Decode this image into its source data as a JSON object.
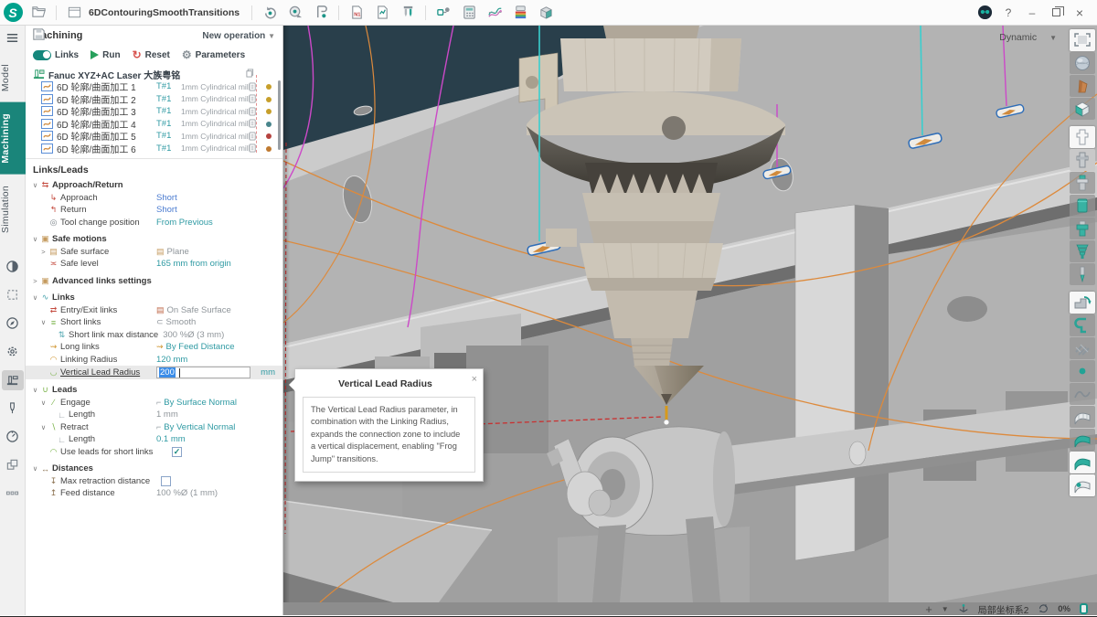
{
  "topbar": {
    "title": "6DContouringSmoothTransitions",
    "window_controls": {
      "help": "?",
      "minimize": "–",
      "close": "×"
    }
  },
  "sidebar": {
    "tabs": [
      {
        "label": "Model"
      },
      {
        "label": "Machining"
      },
      {
        "label": "Simulation"
      }
    ]
  },
  "panel": {
    "title": "Machining",
    "new_operation": "New operation",
    "controls": {
      "links": "Links",
      "run": "Run",
      "reset": "Reset",
      "parameters": "Parameters"
    },
    "machine_row": {
      "label": "Fanuc XYZ+AC Laser 大族粤铭"
    },
    "operations": [
      {
        "label": "6D 轮廓/曲面加工 1",
        "tool_no": "T#1",
        "tool": "1mm Cylindrical mill",
        "dot_color": "#c79f2b"
      },
      {
        "label": "6D 轮廓/曲面加工 2",
        "tool_no": "T#1",
        "tool": "1mm Cylindrical mill",
        "dot_color": "#c79f2b"
      },
      {
        "label": "6D 轮廓/曲面加工 3",
        "tool_no": "T#1",
        "tool": "1mm Cylindrical mill",
        "dot_color": "#c79f2b"
      },
      {
        "label": "6D 轮廓/曲面加工 4",
        "tool_no": "T#1",
        "tool": "1mm Cylindrical mill",
        "dot_color": "#49858c"
      },
      {
        "label": "6D 轮廓/曲面加工 5",
        "tool_no": "T#1",
        "tool": "1mm Cylindrical mill",
        "dot_color": "#b5433f"
      },
      {
        "label": "6D 轮廓/曲面加工 6",
        "tool_no": "T#1",
        "tool": "1mm Cylindrical mill",
        "dot_color": "#bf7a30"
      }
    ],
    "links_leads_title": "Links/Leads",
    "glyphs": {
      "approach-return": "⇆",
      "approach": "↳",
      "return": "↰",
      "tool-change": "◎",
      "safe-motions": "▣",
      "surface": "▤",
      "safe-level": "≍",
      "advanced": "▣",
      "links": "∿",
      "entry-exit": "⇄",
      "short-links": "≡",
      "max-distance": "⇅",
      "long-links": "⇝",
      "linking-radius": "◠",
      "vertical-lead-radius": "◡",
      "leads": "∪",
      "engage": "∕",
      "length": "∟",
      "retract": "∖",
      "use-leads": "◠",
      "distances": "↔",
      "max-retraction": "↧",
      "feed-distance": "↥",
      "plane": "▤",
      "safe-surface": "▤",
      "smooth": "⊂",
      "feed": "⇝",
      "corner": "⌐"
    },
    "tree": [
      {
        "sec": true,
        "chev": "v",
        "icon": "approach-return",
        "ic": "#c44a3e",
        "label": "Approach/Return"
      },
      {
        "ind": 1,
        "icon": "approach",
        "ic": "#c44a3e",
        "label": "Approach",
        "value": "Short",
        "vc": "blue"
      },
      {
        "ind": 1,
        "icon": "return",
        "ic": "#c44a3e",
        "label": "Return",
        "value": "Short",
        "vc": "blue"
      },
      {
        "ind": 1,
        "icon": "tool-change",
        "ic": "#7a8288",
        "label": "Tool change position",
        "value": "From Previous",
        "vc": "teal"
      },
      {
        "sec": true,
        "chev": "v",
        "icon": "safe-motions",
        "ic": "#c49a5e",
        "label": "Safe motions",
        "gap": true
      },
      {
        "ind": 1,
        "chev": ">",
        "icon": "surface",
        "ic": "#c49a5e",
        "label": "Safe surface",
        "value": "Plane",
        "vc": "gray",
        "vicon": "plane",
        "vicolor": "#c49a5e"
      },
      {
        "ind": 1,
        "icon": "safe-level",
        "ic": "#c44a3e",
        "label": "Safe level",
        "value": "165 mm from origin",
        "vc": "teal"
      },
      {
        "sec": true,
        "chev": ">",
        "icon": "advanced",
        "ic": "#c49a5e",
        "label": "Advanced links settings",
        "gap": true
      },
      {
        "sec": true,
        "chev": "v",
        "icon": "links",
        "ic": "#4aa3ad",
        "label": "Links",
        "gap": true
      },
      {
        "ind": 1,
        "icon": "entry-exit",
        "ic": "#c44a3e",
        "label": "Entry/Exit links",
        "value": "On Safe Surface",
        "vc": "gray",
        "vicon": "safe-surface",
        "vicolor": "#c06a4a"
      },
      {
        "ind": 1,
        "chev": "v",
        "icon": "short-links",
        "ic": "#76b043",
        "label": "Short links",
        "value": "Smooth",
        "vc": "gray",
        "vicon": "smooth",
        "vicolor": "#8a9096"
      },
      {
        "ind": 2,
        "icon": "max-distance",
        "ic": "#4aa3ad",
        "label": "Short link max distance",
        "value": "300 %Ø (3 mm)",
        "vc": "gray",
        "inline": true
      },
      {
        "ind": 1,
        "icon": "long-links",
        "ic": "#d0952f",
        "label": "Long links",
        "value": "By Feed Distance",
        "vc": "teal",
        "vicon": "feed",
        "vicolor": "#d0952f"
      },
      {
        "ind": 1,
        "icon": "linking-radius",
        "ic": "#d0952f",
        "label": "Linking Radius",
        "value": "120 mm",
        "vc": "teal"
      },
      {
        "ind": 1,
        "type": "input",
        "icon": "vertical-lead-radius",
        "ic": "#76b043",
        "label": "Vertical Lead Radius",
        "value": "200",
        "unit": "mm",
        "selected": true
      },
      {
        "sec": true,
        "chev": "v",
        "icon": "leads",
        "ic": "#76b043",
        "label": "Leads",
        "gap": true
      },
      {
        "ind": 1,
        "chev": "v",
        "icon": "engage",
        "ic": "#76b043",
        "label": "Engage",
        "value": "By Surface Normal",
        "vc": "teal",
        "vicon": "corner",
        "vicolor": "#98a0a6"
      },
      {
        "ind": 2,
        "icon": "length",
        "ic": "#98a0a6",
        "label": "Length",
        "value": "1 mm",
        "vc": "gray"
      },
      {
        "ind": 1,
        "chev": "v",
        "icon": "retract",
        "ic": "#76b043",
        "label": "Retract",
        "value": "By Vertical Normal",
        "vc": "teal",
        "vicon": "corner",
        "vicolor": "#98a0a6"
      },
      {
        "ind": 2,
        "icon": "length",
        "ic": "#98a0a6",
        "label": "Length",
        "value": "0.1 mm",
        "vc": "teal"
      },
      {
        "ind": 1,
        "type": "check",
        "icon": "use-leads",
        "ic": "#76b043",
        "label": "Use leads for short links",
        "checked": true,
        "cbx": 160
      },
      {
        "sec": true,
        "chev": "v",
        "icon": "distances",
        "ic": "#8a6f4e",
        "label": "Distances",
        "gap": true
      },
      {
        "ind": 1,
        "type": "check",
        "icon": "max-retraction",
        "ic": "#8a6f4e",
        "label": "Max retraction distance",
        "checked": false,
        "cbx": 148
      },
      {
        "ind": 1,
        "icon": "feed-distance",
        "ic": "#8a6f4e",
        "label": "Feed distance",
        "value": "100 %Ø (1 mm)",
        "vc": "gray"
      }
    ]
  },
  "tooltip": {
    "title": "Vertical Lead Radius",
    "close": "×",
    "body": "The Vertical Lead Radius parameter, in combination with the Linking Radius, expands the connection zone to include a vertical displacement, enabling \"Frog Jump\" transitions."
  },
  "viewport": {
    "view_mode": "Dynamic"
  },
  "right_toolbar": {
    "items": [
      {
        "name": "view-fit-icon",
        "shape": "frame",
        "bg": "card"
      },
      {
        "name": "mesh-model-icon",
        "shape": "sphere",
        "bg": "plain"
      },
      {
        "name": "part-model-icon",
        "shape": "wedge",
        "bg": "plain"
      },
      {
        "name": "workpiece-model-icon",
        "shape": "cube",
        "bg": "plain"
      },
      {
        "name": "fixture-visibility-icon",
        "shape": "holder-white",
        "bg": "card",
        "gap": true
      },
      {
        "name": "holder-visibility-icon",
        "shape": "holder-gray",
        "bg": "selected"
      },
      {
        "name": "holder-top-icon",
        "shape": "holder-teal",
        "bg": "plain"
      },
      {
        "name": "tool-cylinder-icon",
        "shape": "cyl-teal",
        "bg": "plain"
      },
      {
        "name": "tool-holder2-icon",
        "shape": "holder-teal2",
        "bg": "plain"
      },
      {
        "name": "tool-stack-icon",
        "shape": "stack-teal",
        "bg": "plain"
      },
      {
        "name": "tool-bit-icon",
        "shape": "bit",
        "bg": "plain"
      },
      {
        "name": "machine-head-icon",
        "shape": "mach-arrow",
        "bg": "card",
        "gap": true
      },
      {
        "name": "clamp-icon",
        "shape": "bracket",
        "bg": "plain"
      },
      {
        "name": "hatch-display-icon",
        "shape": "hatch",
        "bg": "plain"
      },
      {
        "name": "point-display-icon",
        "shape": "dot",
        "bg": "plain"
      },
      {
        "name": "curve-display-icon",
        "shape": "curve",
        "bg": "plain"
      },
      {
        "name": "surface-wireframe-icon",
        "shape": "flag-wire",
        "bg": "plain"
      },
      {
        "name": "surface-shaded-icon",
        "shape": "flag-teal",
        "bg": "plain"
      },
      {
        "name": "surface-card-icon",
        "shape": "flag-teal",
        "bg": "card"
      },
      {
        "name": "surface-points-icon",
        "shape": "flag-dot",
        "bg": "card"
      }
    ]
  },
  "statusbar": {
    "plus": "+",
    "coord_label": "局部坐标系2",
    "progress": "0%"
  }
}
